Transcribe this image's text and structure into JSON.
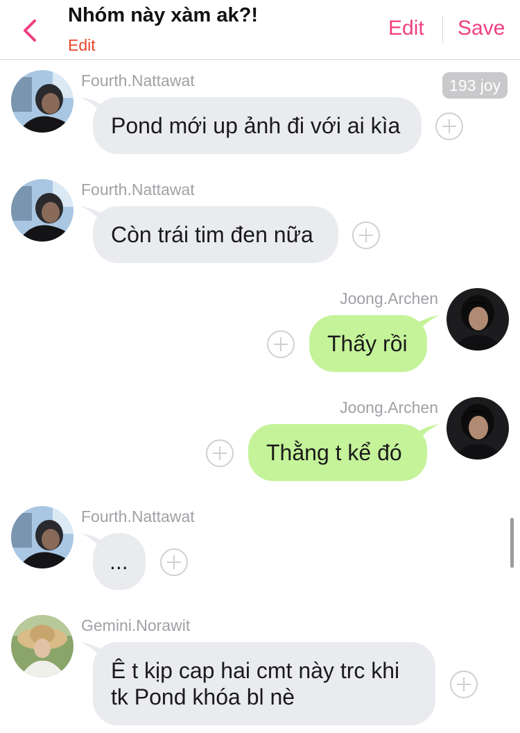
{
  "header": {
    "title": "Nhóm này xàm ak?!",
    "subtitle_edit": "Edit",
    "edit_label": "Edit",
    "save_label": "Save",
    "accent_color": "#ef3f7f"
  },
  "messages": [
    {
      "sender": "Fourth.Nattawat",
      "text": "Pond mới up ảnh đi với ai kìa",
      "side": "left",
      "reaction_badge": "193 joy"
    },
    {
      "sender": "Fourth.Nattawat",
      "text": "Còn trái tim đen nữa",
      "side": "left"
    },
    {
      "sender": "Joong.Archen",
      "text": "Thấy rồi",
      "side": "right"
    },
    {
      "sender": "Joong.Archen",
      "text": "Thằng t kể đó",
      "side": "right"
    },
    {
      "sender": "Fourth.Nattawat",
      "text": "...",
      "side": "left"
    },
    {
      "sender": "Gemini.Norawit",
      "text": "Ê t kịp cap hai cmt này trc khi tk Pond khóa bl nè",
      "side": "left"
    }
  ],
  "icons": {
    "back": "chevron-left-icon",
    "add_reaction": "plus-circle-icon"
  },
  "colors": {
    "left_bubble": "#e9ebef",
    "right_bubble": "#c5f39a",
    "subtitle_edit": "#e8452c"
  }
}
